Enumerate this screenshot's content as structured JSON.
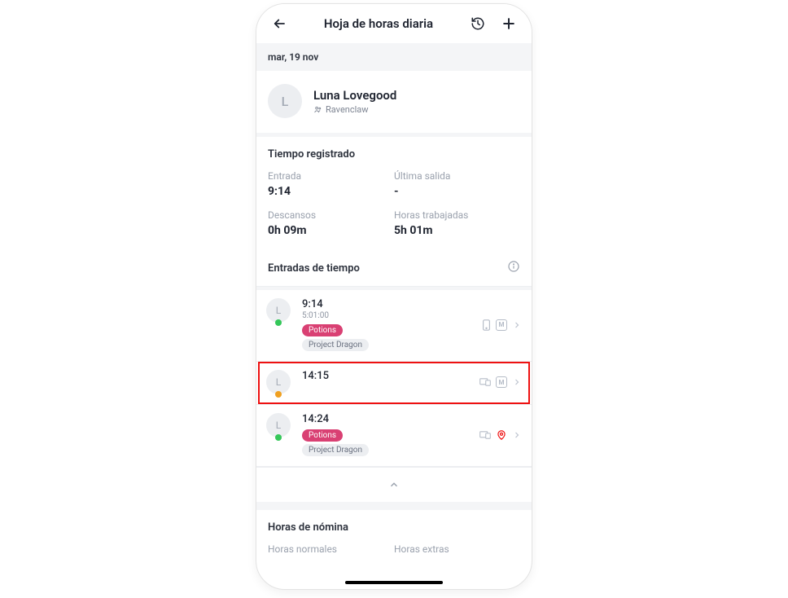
{
  "header": {
    "title": "Hoja de horas diaria"
  },
  "date": "mar, 19 nov",
  "profile": {
    "initial": "L",
    "name": "Luna Lovegood",
    "team": "Ravenclaw"
  },
  "registered": {
    "section_title": "Tiempo registrado",
    "entrada_label": "Entrada",
    "entrada_value": "9:14",
    "salida_label": "Última salida",
    "salida_value": "-",
    "descansos_label": "Descansos",
    "descansos_value": "0h 09m",
    "trabajadas_label": "Horas trabajadas",
    "trabajadas_value": "5h 01m"
  },
  "entries": {
    "title": "Entradas de tiempo",
    "list": [
      {
        "initial": "L",
        "time": "9:14",
        "duration": "5:01:00",
        "activity": "Potions",
        "project": "Project Dragon",
        "status": "green",
        "m_label": "M",
        "highlighted": false
      },
      {
        "initial": "L",
        "time": "14:15",
        "duration": "",
        "activity": "",
        "project": "",
        "status": "orange",
        "m_label": "M",
        "highlighted": true
      },
      {
        "initial": "L",
        "time": "14:24",
        "duration": "",
        "activity": "Potions",
        "project": "Project Dragon",
        "status": "green",
        "m_label": "",
        "highlighted": false
      }
    ]
  },
  "payroll": {
    "title": "Horas de nómina",
    "normal_label": "Horas normales",
    "extra_label": "Horas extras"
  }
}
